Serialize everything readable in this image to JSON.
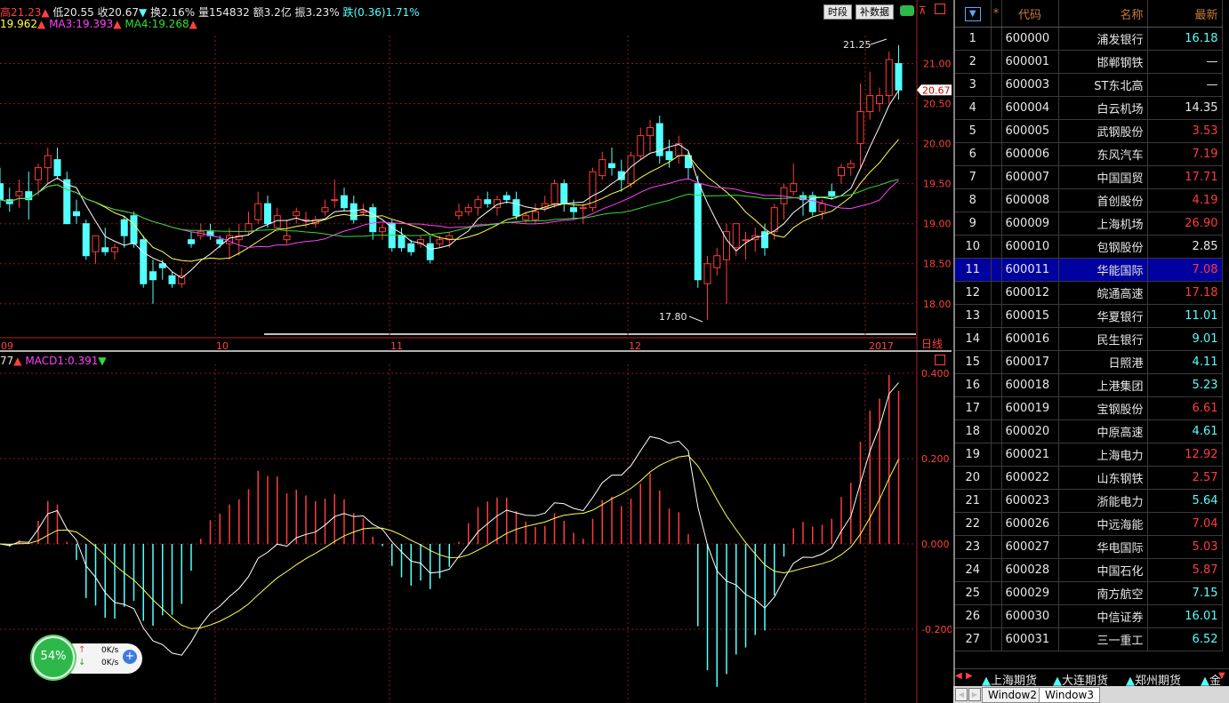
{
  "header": {
    "high": "高21.23",
    "low": "低20.55",
    "close": "收20.67",
    "turnover": "换2.16%",
    "volume": "量154832",
    "amount": "额3.2亿",
    "amplitude": "振3.23%",
    "change": "跌(0.36)1.71%",
    "ma2": "19.962",
    "ma3": "MA3:19.393",
    "ma4": "MA4:19.268"
  },
  "buttons": {
    "period": "时段",
    "supplement": "补数据"
  },
  "price_panel": {
    "current_price_tag": "20.67",
    "high_annotation": "21.25",
    "low_annotation": "17.80",
    "period_label": "日线",
    "y_ticks": [
      "21.00",
      "20.50",
      "20.00",
      "19.50",
      "19.00",
      "18.50",
      "18.00"
    ],
    "x_ticks": [
      "09",
      "10",
      "11",
      "12",
      "2017"
    ]
  },
  "macd_panel": {
    "dif_label": "77",
    "macd_label": "MACD1:0.391",
    "y_ticks": [
      "0.400",
      "0.200",
      "0.000",
      "-0.200"
    ]
  },
  "chart_data": {
    "type": "candlestick",
    "candles": [
      [
        19.5,
        19.7,
        19.2,
        19.3
      ],
      [
        19.3,
        19.45,
        19.15,
        19.25
      ],
      [
        19.35,
        19.55,
        19.2,
        19.4
      ],
      [
        19.4,
        19.65,
        19.05,
        19.3
      ],
      [
        19.55,
        19.75,
        19.35,
        19.7
      ],
      [
        19.7,
        19.95,
        19.5,
        19.85
      ],
      [
        19.8,
        19.95,
        19.55,
        19.6
      ],
      [
        19.55,
        19.65,
        19.0,
        19.0
      ],
      [
        19.15,
        19.3,
        19.0,
        19.1
      ],
      [
        19.0,
        19.05,
        18.55,
        18.6
      ],
      [
        18.65,
        18.85,
        18.5,
        18.85
      ],
      [
        18.7,
        18.95,
        18.6,
        18.65
      ],
      [
        18.65,
        18.75,
        18.55,
        18.7
      ],
      [
        19.05,
        19.1,
        18.7,
        18.85
      ],
      [
        19.1,
        19.15,
        18.7,
        18.75
      ],
      [
        18.8,
        18.85,
        18.2,
        18.25
      ],
      [
        18.4,
        18.55,
        18.0,
        18.3
      ],
      [
        18.5,
        18.55,
        18.3,
        18.45
      ],
      [
        18.35,
        18.4,
        18.2,
        18.25
      ],
      [
        18.25,
        18.45,
        18.2,
        18.35
      ],
      [
        18.8,
        18.9,
        18.7,
        18.75
      ],
      [
        18.85,
        19.0,
        18.8,
        18.9
      ],
      [
        18.9,
        19.0,
        18.8,
        18.85
      ],
      [
        18.8,
        18.85,
        18.7,
        18.75
      ],
      [
        18.75,
        18.95,
        18.55,
        18.85
      ],
      [
        18.8,
        19.0,
        18.6,
        18.85
      ],
      [
        18.9,
        19.15,
        18.85,
        19.0
      ],
      [
        19.05,
        19.4,
        19.0,
        19.25
      ],
      [
        19.25,
        19.35,
        18.95,
        19.0
      ],
      [
        18.95,
        19.2,
        18.9,
        19.1
      ],
      [
        18.8,
        19.05,
        18.75,
        18.85
      ],
      [
        19.1,
        19.2,
        19.0,
        19.15
      ],
      [
        19.05,
        19.15,
        18.95,
        19.05
      ],
      [
        19.0,
        19.1,
        18.95,
        19.05
      ],
      [
        19.15,
        19.3,
        19.1,
        19.2
      ],
      [
        19.3,
        19.55,
        19.2,
        19.3
      ],
      [
        19.35,
        19.45,
        19.15,
        19.2
      ],
      [
        19.25,
        19.35,
        19.0,
        19.05
      ],
      [
        19.15,
        19.25,
        19.1,
        19.15
      ],
      [
        19.2,
        19.25,
        18.8,
        18.9
      ],
      [
        18.9,
        19.0,
        18.8,
        18.95
      ],
      [
        19.0,
        19.05,
        18.65,
        18.7
      ],
      [
        18.85,
        18.95,
        18.65,
        18.7
      ],
      [
        18.75,
        18.8,
        18.6,
        18.65
      ],
      [
        18.75,
        18.85,
        18.7,
        18.8
      ],
      [
        18.75,
        18.85,
        18.5,
        18.55
      ],
      [
        18.75,
        18.85,
        18.7,
        18.8
      ],
      [
        18.8,
        18.9,
        18.7,
        18.85
      ],
      [
        19.1,
        19.25,
        19.05,
        19.15
      ],
      [
        19.15,
        19.25,
        19.1,
        19.2
      ],
      [
        19.2,
        19.35,
        19.1,
        19.3
      ],
      [
        19.3,
        19.4,
        19.2,
        19.25
      ],
      [
        19.2,
        19.35,
        19.1,
        19.3
      ],
      [
        19.35,
        19.4,
        19.25,
        19.3
      ],
      [
        19.3,
        19.4,
        19.05,
        19.1
      ],
      [
        19.05,
        19.15,
        19.0,
        19.1
      ],
      [
        19.05,
        19.25,
        19.0,
        19.15
      ],
      [
        19.2,
        19.35,
        19.15,
        19.25
      ],
      [
        19.25,
        19.55,
        19.2,
        19.5
      ],
      [
        19.5,
        19.55,
        19.15,
        19.25
      ],
      [
        19.2,
        19.3,
        19.05,
        19.15
      ],
      [
        19.2,
        19.25,
        19.0,
        19.2
      ],
      [
        19.2,
        19.7,
        19.15,
        19.65
      ],
      [
        19.6,
        19.9,
        19.55,
        19.8
      ],
      [
        19.75,
        19.95,
        19.6,
        19.7
      ],
      [
        19.65,
        19.8,
        19.4,
        19.55
      ],
      [
        19.5,
        19.9,
        19.45,
        19.85
      ],
      [
        19.85,
        20.2,
        19.8,
        20.1
      ],
      [
        20.1,
        20.3,
        19.9,
        20.2
      ],
      [
        20.25,
        20.35,
        19.75,
        19.85
      ],
      [
        19.9,
        20.05,
        19.7,
        19.8
      ],
      [
        19.85,
        20.1,
        19.75,
        20.0
      ],
      [
        19.85,
        19.9,
        19.55,
        19.7
      ],
      [
        19.5,
        19.6,
        18.2,
        18.3
      ],
      [
        18.25,
        18.6,
        17.8,
        18.5
      ],
      [
        18.45,
        18.7,
        18.35,
        18.6
      ],
      [
        18.55,
        19.0,
        18.0,
        18.9
      ],
      [
        18.7,
        19.0,
        18.6,
        19.0
      ],
      [
        18.8,
        18.9,
        18.55,
        18.8
      ],
      [
        18.8,
        18.95,
        18.65,
        18.85
      ],
      [
        18.9,
        19.0,
        18.6,
        18.7
      ],
      [
        18.9,
        19.25,
        18.8,
        19.2
      ],
      [
        19.25,
        19.5,
        19.05,
        19.45
      ],
      [
        19.4,
        19.75,
        19.35,
        19.5
      ],
      [
        19.35,
        19.4,
        19.1,
        19.3
      ],
      [
        19.35,
        19.4,
        19.1,
        19.15
      ],
      [
        19.15,
        19.3,
        19.05,
        19.25
      ],
      [
        19.4,
        19.5,
        19.3,
        19.35
      ],
      [
        19.6,
        19.75,
        19.5,
        19.7
      ],
      [
        19.7,
        19.8,
        19.6,
        19.75
      ],
      [
        20.0,
        20.75,
        19.7,
        20.4
      ],
      [
        20.4,
        20.9,
        20.3,
        20.6
      ],
      [
        20.5,
        20.7,
        20.4,
        20.6
      ],
      [
        20.6,
        21.15,
        20.5,
        21.05
      ],
      [
        21.0,
        21.23,
        20.55,
        20.67
      ]
    ]
  },
  "stock_list": {
    "headers": {
      "flag": "*",
      "code": "代码",
      "name": "名称",
      "price": "最新"
    },
    "selected_row": 11,
    "rows": [
      {
        "n": "1",
        "code": "600000",
        "name": "浦发银行",
        "price": "16.18",
        "dir": "down"
      },
      {
        "n": "2",
        "code": "600001",
        "name": "邯郸钢铁",
        "price": "—",
        "dir": "flat"
      },
      {
        "n": "3",
        "code": "600003",
        "name": "ST东北高",
        "price": "—",
        "dir": "flat"
      },
      {
        "n": "4",
        "code": "600004",
        "name": "白云机场",
        "price": "14.35",
        "dir": "flat"
      },
      {
        "n": "5",
        "code": "600005",
        "name": "武钢股份",
        "price": "3.53",
        "dir": "up"
      },
      {
        "n": "6",
        "code": "600006",
        "name": "东风汽车",
        "price": "7.19",
        "dir": "up"
      },
      {
        "n": "7",
        "code": "600007",
        "name": "中国国贸",
        "price": "17.71",
        "dir": "up"
      },
      {
        "n": "8",
        "code": "600008",
        "name": "首创股份",
        "price": "4.19",
        "dir": "up"
      },
      {
        "n": "9",
        "code": "600009",
        "name": "上海机场",
        "price": "26.90",
        "dir": "up"
      },
      {
        "n": "10",
        "code": "600010",
        "name": "包钢股份",
        "price": "2.85",
        "dir": "flat"
      },
      {
        "n": "11",
        "code": "600011",
        "name": "华能国际",
        "price": "7.08",
        "dir": "up"
      },
      {
        "n": "12",
        "code": "600012",
        "name": "皖通高速",
        "price": "17.18",
        "dir": "up"
      },
      {
        "n": "13",
        "code": "600015",
        "name": "华夏银行",
        "price": "11.01",
        "dir": "down"
      },
      {
        "n": "14",
        "code": "600016",
        "name": "民生银行",
        "price": "9.01",
        "dir": "down"
      },
      {
        "n": "15",
        "code": "600017",
        "name": "日照港",
        "price": "4.11",
        "dir": "down"
      },
      {
        "n": "16",
        "code": "600018",
        "name": "上港集团",
        "price": "5.23",
        "dir": "down"
      },
      {
        "n": "17",
        "code": "600019",
        "name": "宝钢股份",
        "price": "6.61",
        "dir": "up"
      },
      {
        "n": "18",
        "code": "600020",
        "name": "中原高速",
        "price": "4.61",
        "dir": "down"
      },
      {
        "n": "19",
        "code": "600021",
        "name": "上海电力",
        "price": "12.92",
        "dir": "up"
      },
      {
        "n": "20",
        "code": "600022",
        "name": "山东钢铁",
        "price": "2.57",
        "dir": "up"
      },
      {
        "n": "21",
        "code": "600023",
        "name": "浙能电力",
        "price": "5.64",
        "dir": "down"
      },
      {
        "n": "22",
        "code": "600026",
        "name": "中远海能",
        "price": "7.04",
        "dir": "up"
      },
      {
        "n": "23",
        "code": "600027",
        "name": "华电国际",
        "price": "5.03",
        "dir": "up"
      },
      {
        "n": "24",
        "code": "600028",
        "name": "中国石化",
        "price": "5.87",
        "dir": "up"
      },
      {
        "n": "25",
        "code": "600029",
        "name": "南方航空",
        "price": "7.15",
        "dir": "down"
      },
      {
        "n": "26",
        "code": "600030",
        "name": "中信证券",
        "price": "16.01",
        "dir": "down"
      },
      {
        "n": "27",
        "code": "600031",
        "name": "三一重工",
        "price": "6.52",
        "dir": "down"
      }
    ]
  },
  "market_tabs": [
    "上海期货",
    "大连期货",
    "郑州期货",
    "金"
  ],
  "window_tabs": [
    "Window2",
    "Window3"
  ],
  "net_widget": {
    "percent": "54%",
    "up_speed": "0K/s",
    "down_speed": "0K/s"
  },
  "colors": {
    "up": "#ff3b3b",
    "down": "#54ffff",
    "ma1": "#ffffff",
    "ma2": "#ffff55",
    "ma3": "#ff40ff",
    "ma4": "#33dd33",
    "grid": "#8a1a1a",
    "select": "#0000a0"
  }
}
